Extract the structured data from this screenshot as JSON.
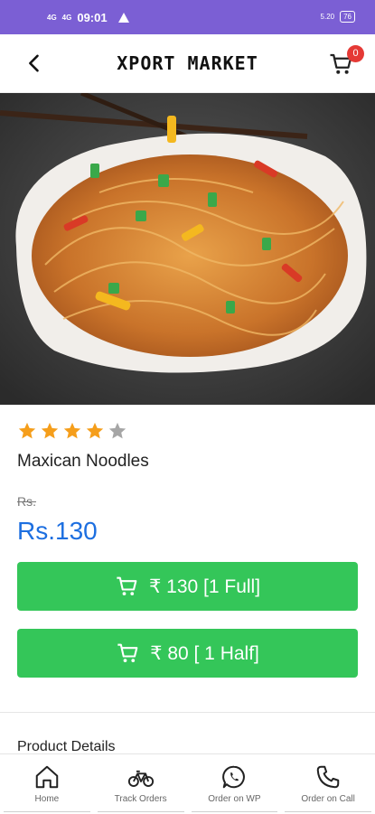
{
  "status_bar": {
    "signal_1": "4G",
    "signal_2": "4G",
    "time": "09:01",
    "speed": "5.20",
    "battery": "76"
  },
  "app_bar": {
    "title": "XPORT MARKET",
    "cart_count": "0"
  },
  "product": {
    "rating": 4,
    "rating_max": 5,
    "name": "Maxican Noodles",
    "mrp_label": "Rs.",
    "price": "Rs.130",
    "buttons": [
      {
        "label": "₹ 130  [1 Full]"
      },
      {
        "label": "₹ 80  [ 1 Half]"
      }
    ],
    "details_heading": "Product Details"
  },
  "bottom_nav": {
    "items": [
      {
        "label": "Home",
        "icon": "home-icon"
      },
      {
        "label": "Track Orders",
        "icon": "bicycle-icon"
      },
      {
        "label": "Order on WP",
        "icon": "whatsapp-icon"
      },
      {
        "label": "Order on Call",
        "icon": "phone-icon"
      }
    ]
  },
  "colors": {
    "status_bar": "#7b5fd4",
    "price": "#1d6fe0",
    "button": "#34c659",
    "star_on": "#f59e1b",
    "star_off": "#a6a6a6",
    "badge": "#e53935"
  }
}
